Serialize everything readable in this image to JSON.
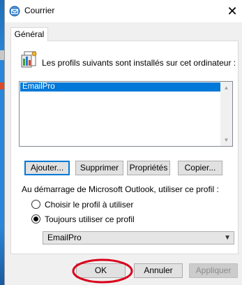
{
  "window": {
    "title": "Courrier",
    "close_symbol": "✕"
  },
  "tabs": [
    {
      "label": "Général"
    }
  ],
  "intro_text": "Les profils suivants sont installés sur cet ordinateur :",
  "profiles": [
    {
      "label": "EmailPro",
      "selected": true
    }
  ],
  "profile_buttons": {
    "add": "Ajouter...",
    "remove": "Supprimer",
    "properties": "Propriétés",
    "copy": "Copier..."
  },
  "startup": {
    "label": "Au démarrage de Microsoft Outlook, utiliser ce profil :",
    "option_prompt": "Choisir le profil à utiliser",
    "option_always": "Toujours utiliser ce profil",
    "selected_option": "always",
    "profile_value": "EmailPro"
  },
  "footer_buttons": {
    "ok": "OK",
    "cancel": "Annuler",
    "apply": "Appliquer"
  },
  "colors": {
    "selection": "#0078d7",
    "highlight_annotation": "#d9001b"
  },
  "icons": {
    "title": "mail-app-icon",
    "profiles": "profiles-icon",
    "close": "close-icon",
    "scroll_up": "scroll-up-arrow-icon",
    "scroll_down": "scroll-down-arrow-icon",
    "combo": "chevron-down-icon"
  }
}
